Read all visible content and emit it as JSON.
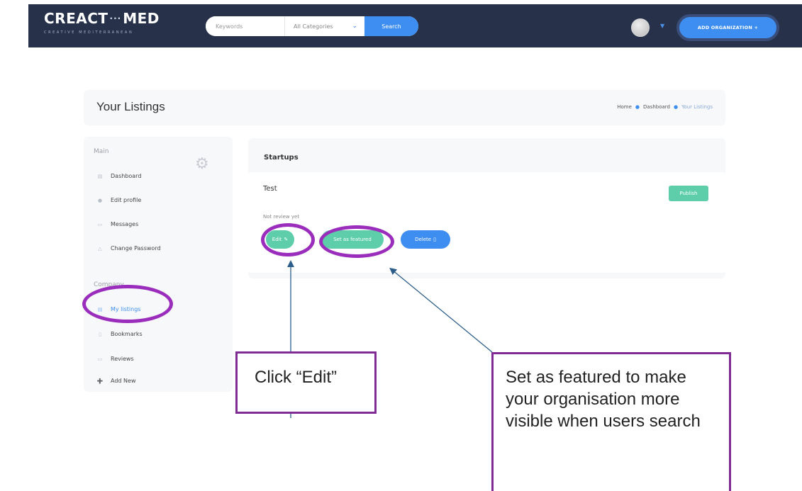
{
  "header": {
    "logo_text_left": "CREACT",
    "logo_text_right": "MED",
    "logo_dots": "···",
    "logo_tagline": "CREATIVE MEDITERRANEAN",
    "search": {
      "keywords_placeholder": "Keywords",
      "category_selected": "All Categories",
      "search_label": "Search"
    },
    "add_organization_label": "ADD ORGANIZATION +"
  },
  "title_bar": {
    "title": "Your Listings",
    "breadcrumb": [
      "Home",
      "Dashboard",
      "Your Listings"
    ]
  },
  "sidebar": {
    "section_main": "Main",
    "main_items": [
      {
        "label": "Dashboard",
        "icon": "dashboard-icon"
      },
      {
        "label": "Edit profile",
        "icon": "user-icon"
      },
      {
        "label": "Messages",
        "icon": "message-icon"
      },
      {
        "label": "Change Password",
        "icon": "lock-icon"
      }
    ],
    "section_company": "Company",
    "company_items": [
      {
        "label": "My listings",
        "icon": "list-icon"
      },
      {
        "label": "Bookmarks",
        "icon": "bookmark-icon"
      },
      {
        "label": "Reviews",
        "icon": "review-icon"
      },
      {
        "label": "Add New",
        "icon": "plus-icon"
      }
    ]
  },
  "listings": {
    "heading": "Startups",
    "item": {
      "title": "Test",
      "publish_label": "Publish",
      "status": "Not review yet",
      "edit_label": "Edit",
      "feature_label": "Set as featured",
      "delete_label": "Delete"
    }
  },
  "annotations": {
    "edit_callout": "Click “Edit”",
    "feature_callout": "Set as featured to make your organisation more visible when users search"
  },
  "colors": {
    "navbar": "#27314a",
    "accent_blue": "#3d8ef0",
    "accent_green": "#5dcea9",
    "annotation_purple": "#9a2dbb",
    "arrow_blue": "#2d5d8a"
  }
}
